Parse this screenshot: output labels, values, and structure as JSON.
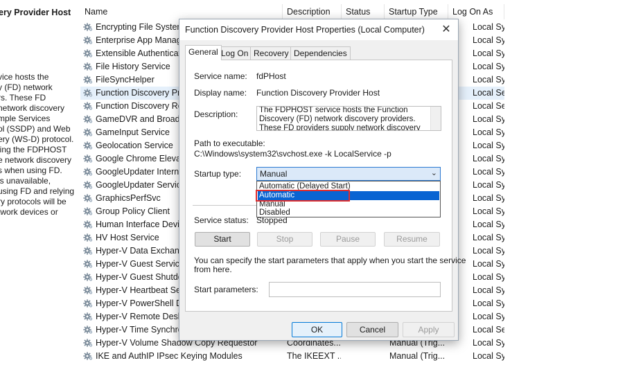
{
  "left_pane": {
    "title": "ery Provider Host",
    "description_lines": [
      "vice hosts the",
      "y (FD) network",
      "rs. These FD",
      "network discovery",
      "mple Services",
      "ol (SSDP) and Web",
      "ery (WS-D) protocol.",
      "ling the FDPHOST",
      "e network discovery",
      "s when using FD.",
      " is unavailable,",
      "using FD and relying",
      "ry protocols will be",
      "twork devices or"
    ]
  },
  "columns": {
    "name": "Name",
    "description": "Description",
    "status": "Status",
    "startup_type": "Startup Type",
    "log_on_as": "Log On As"
  },
  "services": [
    {
      "name": "Encrypting File System",
      "description": "",
      "status": "",
      "startup": "",
      "logon": "Local Syste..."
    },
    {
      "name": "Enterprise App Manage",
      "description": "",
      "status": "",
      "startup": "",
      "logon": "Local Syste..."
    },
    {
      "name": "Extensible Authenticat",
      "description": "",
      "status": "",
      "startup": "",
      "logon": "Local Syste..."
    },
    {
      "name": "File History Service",
      "description": "",
      "status": "",
      "startup": "",
      "logon": "Local Syste..."
    },
    {
      "name": "FileSyncHelper",
      "description": "",
      "status": "",
      "startup": "",
      "logon": "Local Syste..."
    },
    {
      "name": "Function Discovery Pro",
      "description": "",
      "status": "",
      "startup": "",
      "logon": "Local Service",
      "selected": true
    },
    {
      "name": "Function Discovery Res",
      "description": "",
      "status": "",
      "startup": "",
      "logon": "Local Service"
    },
    {
      "name": "GameDVR and Broadca",
      "description": "",
      "status": "",
      "startup": "",
      "logon": "Local Syste..."
    },
    {
      "name": "GameInput Service",
      "description": "",
      "status": "",
      "startup": "",
      "logon": "Local Syste..."
    },
    {
      "name": "Geolocation Service",
      "description": "",
      "status": "",
      "startup": "",
      "logon": "Local Syste..."
    },
    {
      "name": "Google Chrome Elevat",
      "description": "",
      "status": "",
      "startup": "",
      "logon": "Local Syste..."
    },
    {
      "name": "GoogleUpdater Interna",
      "description": "",
      "status": "",
      "startup": "",
      "logon": "Local Syste..."
    },
    {
      "name": "GoogleUpdater Service",
      "description": "",
      "status": "",
      "startup": "",
      "logon": "Local Syste..."
    },
    {
      "name": "GraphicsPerfSvc",
      "description": "",
      "status": "",
      "startup": "",
      "logon": "Local Syste..."
    },
    {
      "name": "Group Policy Client",
      "description": "",
      "status": "",
      "startup": "",
      "logon": "Local Syste..."
    },
    {
      "name": "Human Interface Devic",
      "description": "",
      "status": "",
      "startup": "",
      "logon": "Local Syste..."
    },
    {
      "name": "HV Host Service",
      "description": "",
      "status": "",
      "startup": "",
      "logon": "Local Syste..."
    },
    {
      "name": "Hyper-V Data Exchang",
      "description": "",
      "status": "",
      "startup": "",
      "logon": "Local Syste..."
    },
    {
      "name": "Hyper-V Guest Service",
      "description": "",
      "status": "",
      "startup": "",
      "logon": "Local Syste..."
    },
    {
      "name": "Hyper-V Guest Shutdo",
      "description": "",
      "status": "",
      "startup": "",
      "logon": "Local Syste..."
    },
    {
      "name": "Hyper-V Heartbeat Ser",
      "description": "",
      "status": "",
      "startup": "",
      "logon": "Local Syste..."
    },
    {
      "name": "Hyper-V PowerShell Di",
      "description": "",
      "status": "",
      "startup": "",
      "logon": "Local Syste..."
    },
    {
      "name": "Hyper-V Remote Deskt",
      "description": "",
      "status": "",
      "startup": "",
      "logon": "Local Syste..."
    },
    {
      "name": "Hyper-V Time Synchro",
      "description": "",
      "status": "",
      "startup": "",
      "logon": "Local Service"
    },
    {
      "name": "Hyper-V Volume Shadow Copy Requestor",
      "description": "Coordinates...",
      "status": "",
      "startup": "Manual (Trig...",
      "logon": "Local Syste..."
    },
    {
      "name": "IKE and AuthIP IPsec Keying Modules",
      "description": "The IKEEXT ...",
      "status": "",
      "startup": "Manual (Trig...",
      "logon": "Local Syste..."
    }
  ],
  "dialog": {
    "title": "Function Discovery Provider Host Properties (Local Computer)",
    "close_glyph": "✕",
    "tabs": [
      "General",
      "Log On",
      "Recovery",
      "Dependencies"
    ],
    "service_name_label": "Service name:",
    "service_name_value": "fdPHost",
    "display_name_label": "Display name:",
    "display_name_value": "Function Discovery Provider Host",
    "description_label": "Description:",
    "description_value": "The FDPHOST service hosts the Function Discovery (FD) network discovery providers. These FD providers supply network discovery services for",
    "path_label": "Path to executable:",
    "path_value": "C:\\Windows\\system32\\svchost.exe -k LocalService -p",
    "startup_type_label": "Startup type:",
    "startup_type_value": "Manual",
    "startup_options": [
      "Automatic (Delayed Start)",
      "Automatic",
      "Manual",
      "Disabled"
    ],
    "highlighted_option": "Automatic",
    "service_status_label": "Service status:",
    "service_status_value": "Stopped",
    "buttons": {
      "start": "Start",
      "stop": "Stop",
      "pause": "Pause",
      "resume": "Resume"
    },
    "hint_line1": "You can specify the start parameters that apply when you start the service",
    "hint_line2": "from here.",
    "start_params_label": "Start parameters:",
    "start_params_value": "",
    "footer": {
      "ok": "OK",
      "cancel": "Cancel",
      "apply": "Apply"
    }
  },
  "colors": {
    "highlight": "#0a64d2",
    "annotation_box": "#e02d2d",
    "selected_row": "#e5f0fb"
  }
}
